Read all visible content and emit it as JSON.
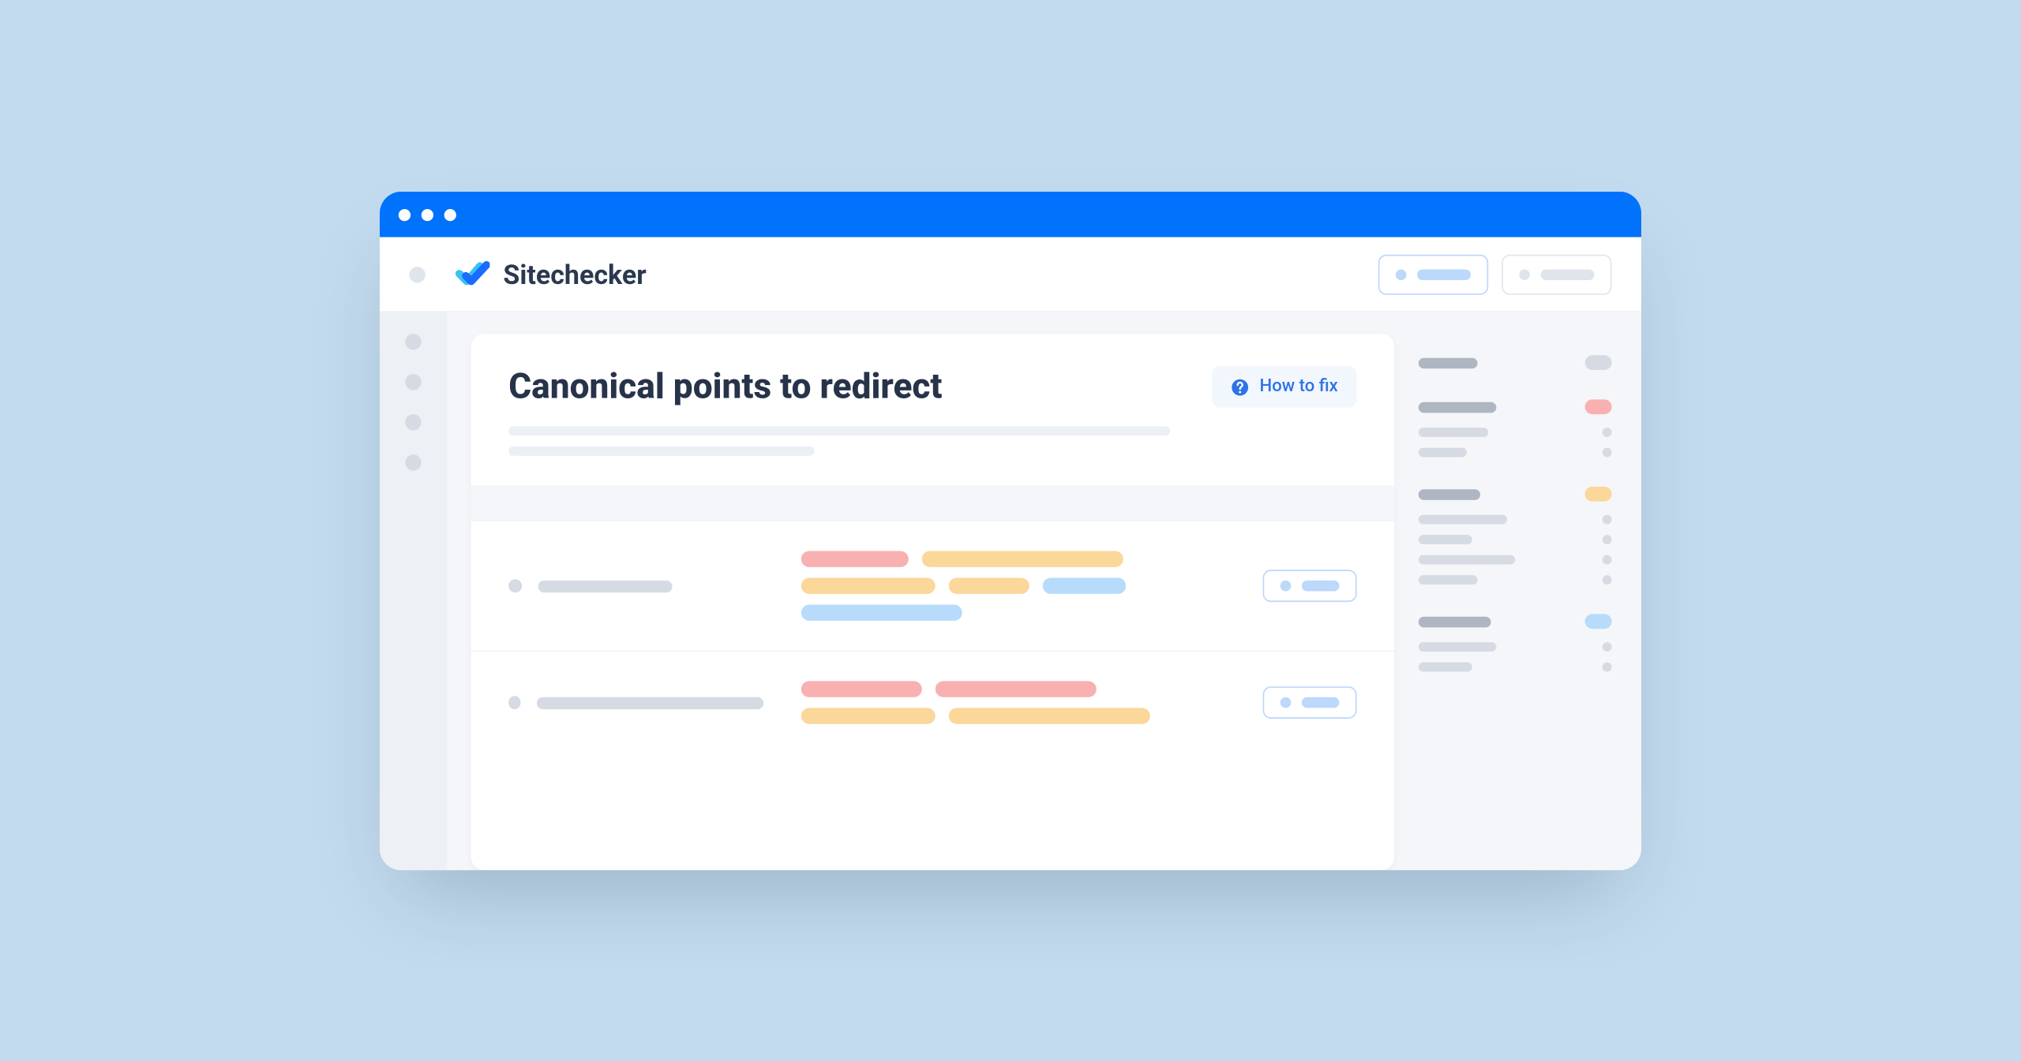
{
  "app": {
    "name": "Sitechecker"
  },
  "page": {
    "title": "Canonical points to redirect",
    "how_to_fix_label": "How to fix"
  }
}
